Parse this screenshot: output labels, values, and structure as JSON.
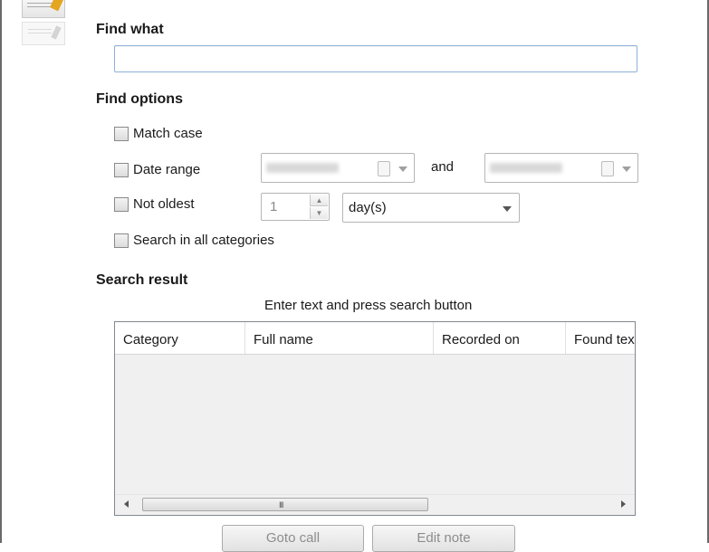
{
  "find_what": {
    "heading": "Find what",
    "value": ""
  },
  "find_options": {
    "heading": "Find options",
    "match_case": "Match case",
    "date_range": "Date range",
    "and_label": "and",
    "not_oldest": "Not oldest",
    "not_oldest_value": "1",
    "unit": "day(s)",
    "search_all": "Search in all categories"
  },
  "search_result": {
    "heading": "Search result",
    "hint": "Enter text and press search button",
    "columns": [
      "Category",
      "Full name",
      "Recorded on",
      "Found tex"
    ],
    "scroll_grip": "III"
  },
  "buttons": {
    "goto_call": "Goto call",
    "edit_note": "Edit note"
  },
  "icons": {
    "sidebar": [
      "notes-pencil-icon",
      "notes-pencil-disabled-icon"
    ],
    "combo_arrow": "chevron-down-icon",
    "calendar": "calendar-icon"
  },
  "colors": {
    "input_border": "#8eb1d9",
    "disabled_text": "#8d8d8d"
  }
}
